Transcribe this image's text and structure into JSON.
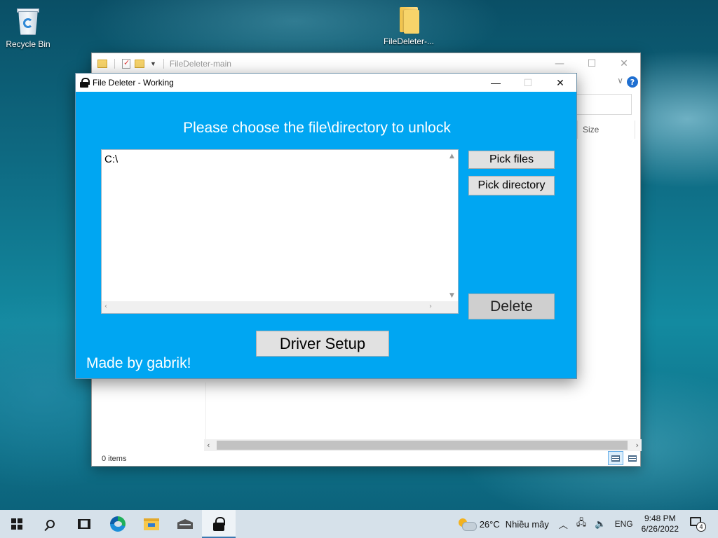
{
  "desktop": {
    "icons": [
      {
        "label": "Recycle Bin",
        "icon": "recycle-bin-icon"
      },
      {
        "label": "FileDeleter-...",
        "icon": "folder-icon"
      }
    ]
  },
  "explorer": {
    "title": "FileDeleter-main",
    "column_size": "Size",
    "status": "0 items",
    "controls": {
      "minimize": "—",
      "maximize": "☐",
      "close": "✕"
    },
    "help": "?",
    "dropdown": "∨"
  },
  "file_deleter": {
    "title": "File Deleter - Working",
    "heading": "Please choose the file\\directory to unlock",
    "list_items": [
      "C:\\"
    ],
    "buttons": {
      "pick_files": "Pick files",
      "pick_directory": "Pick directory",
      "delete": "Delete",
      "driver_setup": "Driver Setup"
    },
    "credit": "Made by gabrik!",
    "controls": {
      "minimize": "—",
      "maximize": "☐",
      "close": "✕"
    },
    "accent_color": "#00a6f2"
  },
  "taskbar": {
    "weather": {
      "temp": "26°C",
      "condition": "Nhiều mây"
    },
    "language": "ENG",
    "time": "9:48 PM",
    "date": "6/26/2022",
    "notification_count": "4",
    "apps": [
      "start-icon",
      "search-icon",
      "task-view-icon",
      "edge-icon",
      "file-explorer-icon",
      "mail-icon",
      "lock-app-icon"
    ]
  }
}
